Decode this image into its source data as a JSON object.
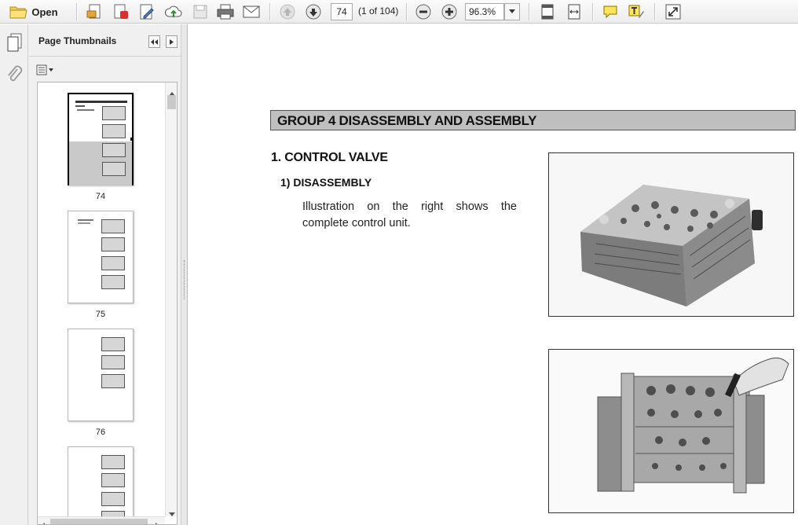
{
  "toolbar": {
    "open_label": "Open",
    "page_number": "74",
    "page_count": "(1 of 104)",
    "zoom_level": "96.3%"
  },
  "panel": {
    "title": "Page Thumbnails",
    "thumbnails": [
      {
        "label": "74",
        "selected": true
      },
      {
        "label": "75",
        "selected": false
      },
      {
        "label": "76",
        "selected": false
      }
    ]
  },
  "document": {
    "group_header": "GROUP 4 DISASSEMBLY AND ASSEMBLY",
    "section_title": "1. CONTROL VALVE",
    "sub_title": "1) DISASSEMBLY",
    "body_text": "Illustration on the right shows the complete control unit."
  },
  "colors": {
    "header_fill": "#bfbfbf",
    "toolbar_bg": "#ececec",
    "selection_border": "#000000"
  }
}
